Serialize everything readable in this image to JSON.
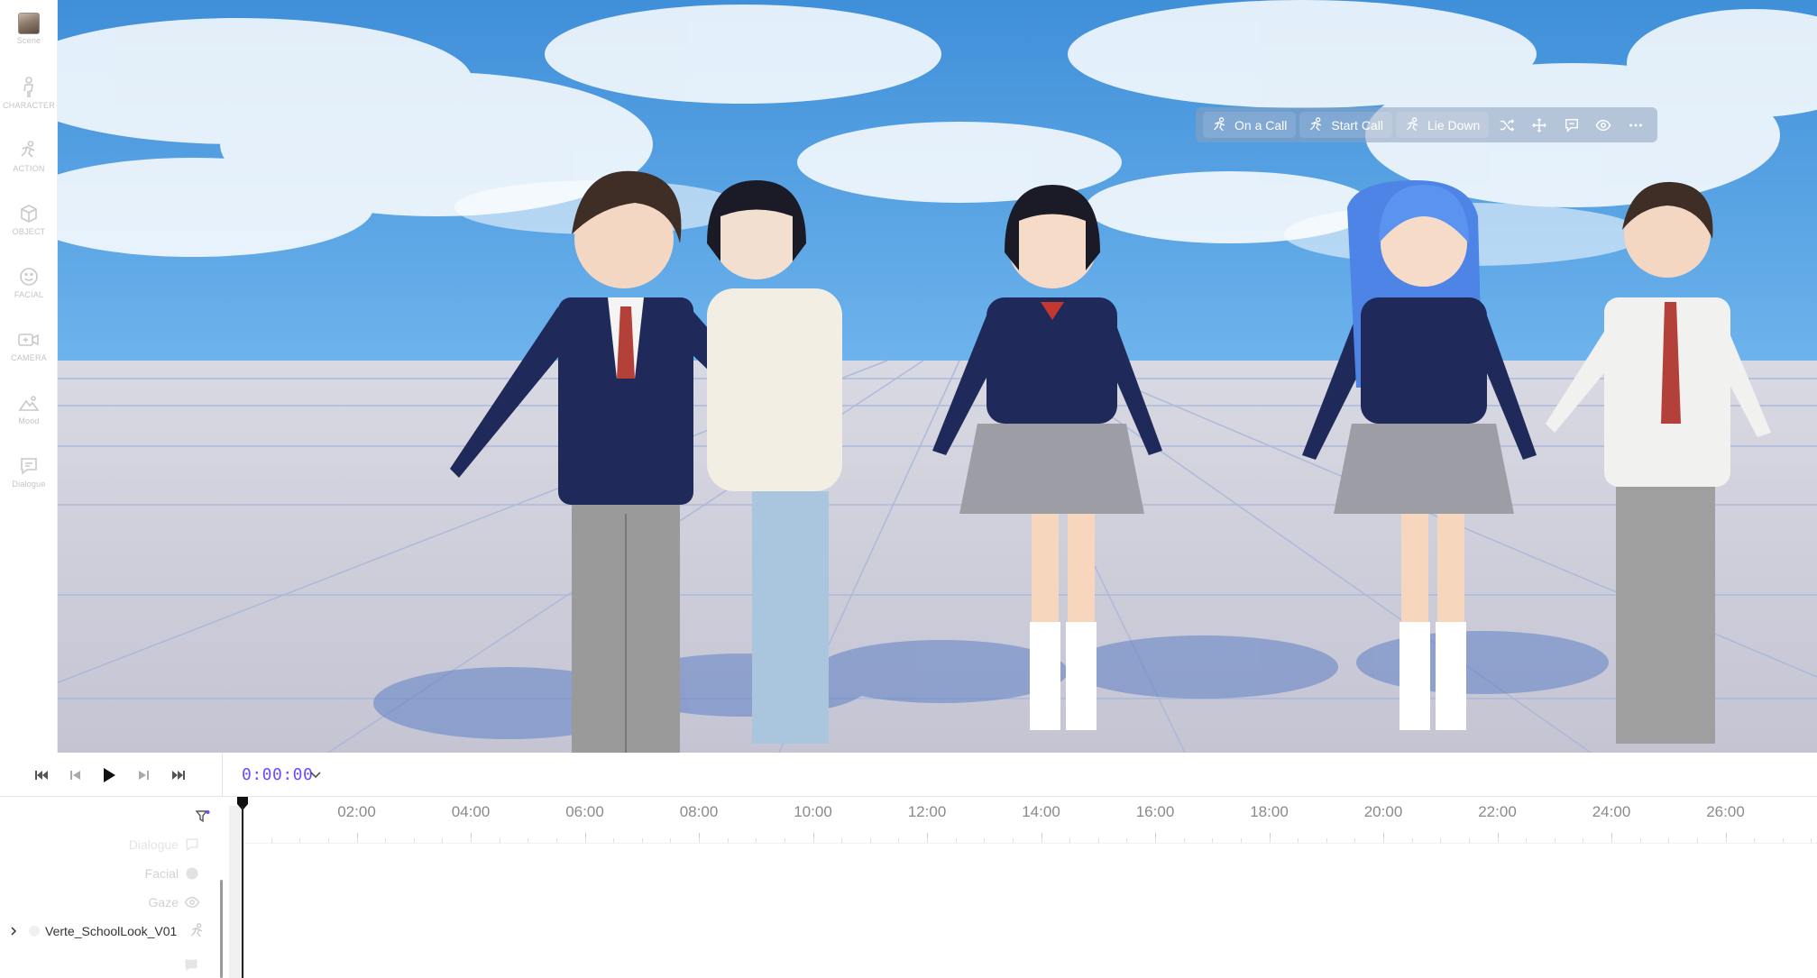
{
  "rail": {
    "items": [
      {
        "label": "Scene",
        "icon": "scene-thumbnail"
      },
      {
        "label": "CHARACTER",
        "icon": "character-icon"
      },
      {
        "label": "ACTION",
        "icon": "action-icon"
      },
      {
        "label": "OBJECT",
        "icon": "cube-icon"
      },
      {
        "label": "FACIAL",
        "icon": "smile-icon"
      },
      {
        "label": "CAMERA",
        "icon": "camera-icon"
      },
      {
        "label": "Mood",
        "icon": "mountain-icon"
      },
      {
        "label": "Dialogue",
        "icon": "chat-icon"
      }
    ]
  },
  "toolbar": {
    "actions": [
      {
        "label": "On a Call",
        "icon": "motion-icon"
      },
      {
        "label": "Start Call",
        "icon": "motion-icon"
      },
      {
        "label": "Lie Down",
        "icon": "motion-icon"
      }
    ],
    "icons": [
      "shuffle-icon",
      "move-icon",
      "comment-icon",
      "eye-icon",
      "more-icon"
    ]
  },
  "transport": {
    "timecode": "0:00:00",
    "buttons": [
      "skip-start-icon",
      "step-back-icon",
      "play-icon",
      "step-forward-icon",
      "skip-end-icon"
    ]
  },
  "timeline": {
    "ticks": [
      "02:00",
      "04:00",
      "06:00",
      "08:00",
      "10:00",
      "12:00",
      "14:00",
      "16:00",
      "18:00",
      "20:00",
      "22:00",
      "24:00",
      "26:00"
    ],
    "tracks": [
      {
        "label": "Dialogue",
        "icon": "chat-icon"
      },
      {
        "label": "Facial",
        "icon": "smile-icon"
      },
      {
        "label": "Gaze",
        "icon": "eye-icon"
      }
    ],
    "character_track": "Verte_SchoolLook_V01"
  },
  "colors": {
    "accent": "#6a4dff",
    "sky": "#4a9be0",
    "floor": "#c9c9d6"
  }
}
